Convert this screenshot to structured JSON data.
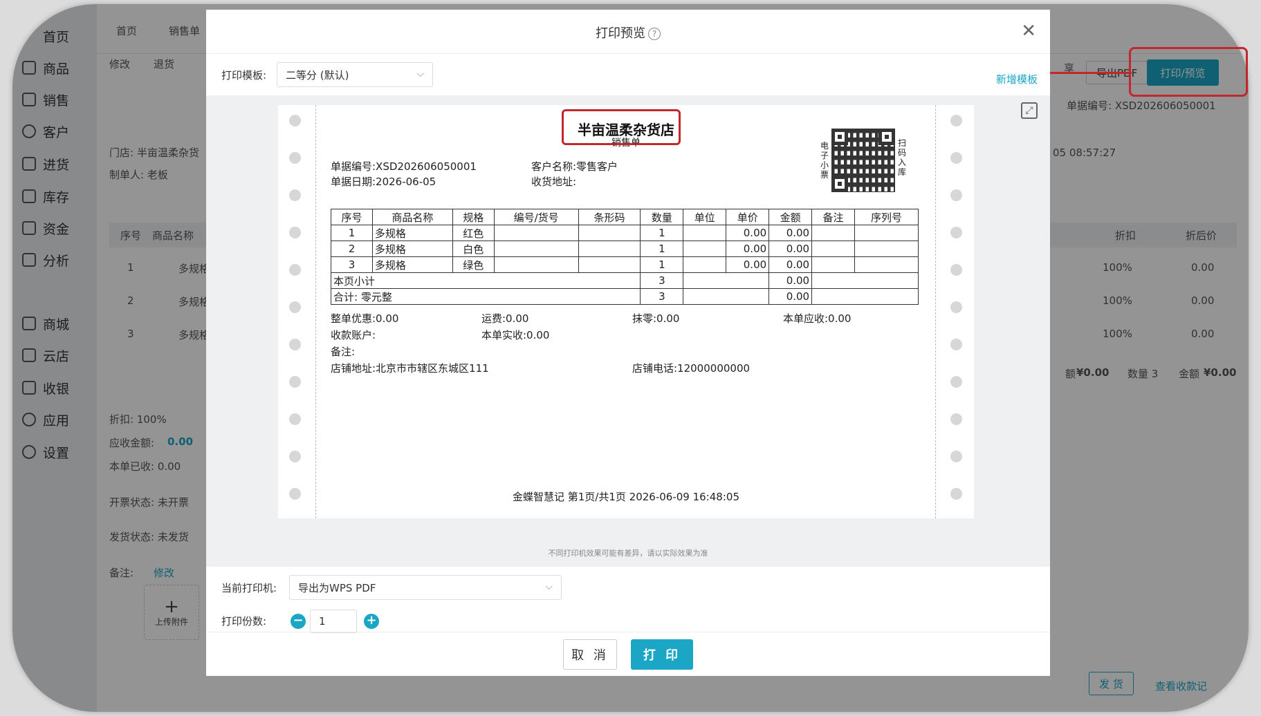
{
  "sidebar": {
    "items": [
      "首页",
      "商品",
      "销售",
      "客户",
      "进货",
      "库存",
      "资金",
      "分析",
      "商城",
      "云店",
      "收银",
      "应用",
      "设置"
    ]
  },
  "back": {
    "tabs": [
      "首页",
      "销售单"
    ],
    "toolbar": {
      "edit": "修改",
      "return": "退货",
      "share": "享",
      "export_pdf": "导出PDF",
      "print_preview": "打印/预览"
    },
    "store_label": "门店:",
    "store_value": "半亩温柔杂货",
    "creator": "制单人: 老板",
    "doc_no": "单据编号: XSD202606050001",
    "doc_time": "05 08:57:27",
    "table_headers": [
      "序号",
      "商品名称",
      "折扣",
      "折后价"
    ],
    "rows": [
      {
        "no": "1",
        "name": "多规格",
        "discount": "100%",
        "price": "0.00"
      },
      {
        "no": "2",
        "name": "多规格",
        "discount": "100%",
        "price": "0.00"
      },
      {
        "no": "3",
        "name": "多规格",
        "discount": "100%",
        "price": "0.00"
      }
    ],
    "summary": {
      "amount_label": "额",
      "amount": "¥0.00",
      "qty": "数量 3",
      "total_label": "金额",
      "total": "¥0.00"
    },
    "discount": "折扣: 100%",
    "receivable_label": "应收金额:",
    "receivable": "0.00",
    "received": "本单已收: 0.00",
    "invoice": "开票状态:  未开票",
    "ship": "发货状态:  未发货",
    "remark_label": "备注:",
    "remark_edit": "修改",
    "upload": "上传附件",
    "ship_btn": "发 货",
    "view_payment": "查看收款记"
  },
  "modal": {
    "title": "打印预览",
    "template_label": "打印模板:",
    "template_value": "二等分 (默认)",
    "add_template": "新增模板",
    "tip": "不同打印机效果可能有差异，请以实际效果为准",
    "printer_label": "当前打印机:",
    "printer_value": "导出为WPS PDF",
    "copies_label": "打印份数:",
    "copies_value": "1",
    "cancel": "取 消",
    "print": "打 印"
  },
  "receipt": {
    "shop_name": "半亩温柔杂货店",
    "doc_type": "销售单",
    "doc_no": "单据编号:XSD202606050001",
    "doc_date": "单据日期:2026-06-05",
    "customer": "客户名称:零售客户",
    "address": "收货地址:",
    "qr_left": "电子小票",
    "qr_right": "扫码入库",
    "headers": [
      "序号",
      "商品名称",
      "规格",
      "编号/货号",
      "条形码",
      "数量",
      "单位",
      "单价",
      "金额",
      "备注",
      "序列号"
    ],
    "rows": [
      {
        "no": "1",
        "name": "多规格",
        "spec": "红色",
        "qty": "1",
        "price": "0.00",
        "amount": "0.00"
      },
      {
        "no": "2",
        "name": "多规格",
        "spec": "白色",
        "qty": "1",
        "price": "0.00",
        "amount": "0.00"
      },
      {
        "no": "3",
        "name": "多规格",
        "spec": "绿色",
        "qty": "1",
        "price": "0.00",
        "amount": "0.00"
      }
    ],
    "subtotal_label": "本页小计",
    "subtotal_qty": "3",
    "subtotal_amount": "0.00",
    "total_label": "合计: 零元整",
    "total_qty": "3",
    "total_amount": "0.00",
    "whole_discount": "整单优惠:0.00",
    "freight": "运费:0.00",
    "round_off": "抹零:0.00",
    "receivable": "本单应收:0.00",
    "account": "收款账户:",
    "actual_received": "本单实收:0.00",
    "remark": "备注:",
    "shop_address": "店铺地址:北京市市辖区东城区111",
    "shop_phone": "店铺电话:12000000000",
    "footer": "金蝶智慧记   第1页/共1页   2026-06-09 16:48:05"
  }
}
